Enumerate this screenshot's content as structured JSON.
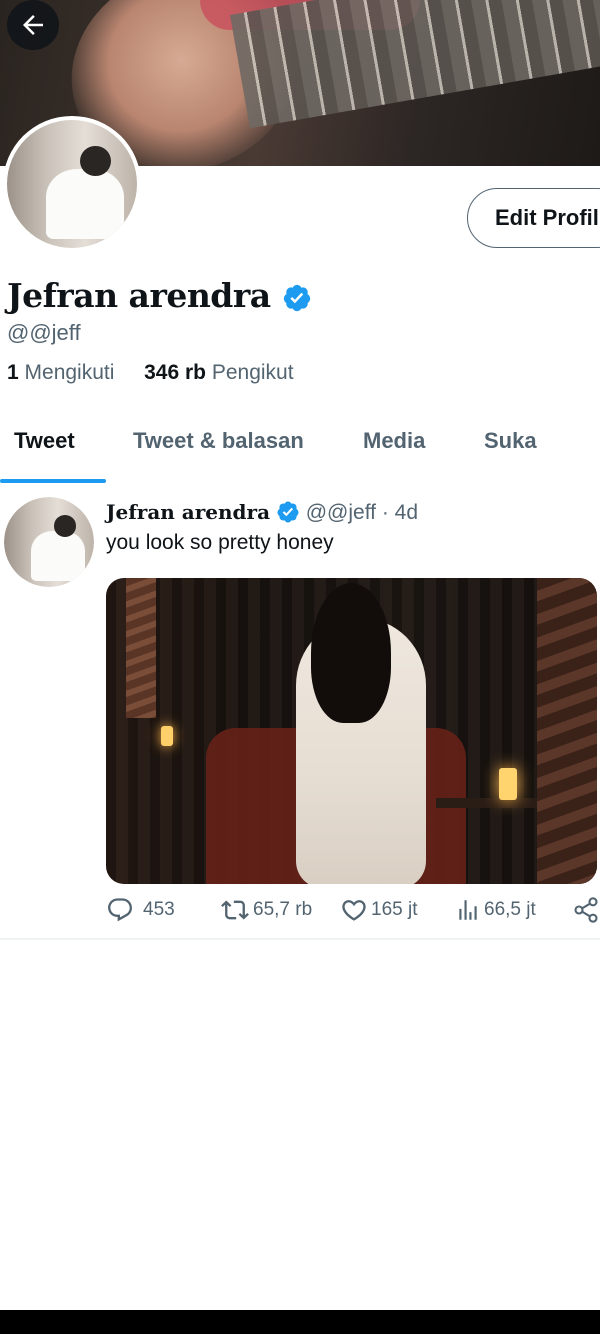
{
  "profile": {
    "name": "Jefran arendra",
    "handle": "@@jeff",
    "edit_button": "Edit Profil",
    "following_count": "1",
    "following_label": "Mengikuti",
    "followers_count": "346 rb",
    "followers_label": "Pengikut"
  },
  "tabs": [
    {
      "label": "Tweet"
    },
    {
      "label": "Tweet & balasan"
    },
    {
      "label": "Media"
    },
    {
      "label": "Suka"
    }
  ],
  "tweet": {
    "name": "Jefran arendra",
    "handle": "@@jeff",
    "time": "· 4d",
    "text": "you look so pretty honey",
    "replies": "453",
    "retweets": "65,7 rb",
    "likes": "165 jt",
    "views": "66,5 jt"
  },
  "colors": {
    "accent": "#1d9bf0",
    "text_primary": "#0f1419",
    "text_secondary": "#536471"
  },
  "icons": [
    "back-arrow-icon",
    "verified-badge-icon",
    "reply-icon",
    "retweet-icon",
    "like-icon",
    "views-icon",
    "share-icon"
  ]
}
